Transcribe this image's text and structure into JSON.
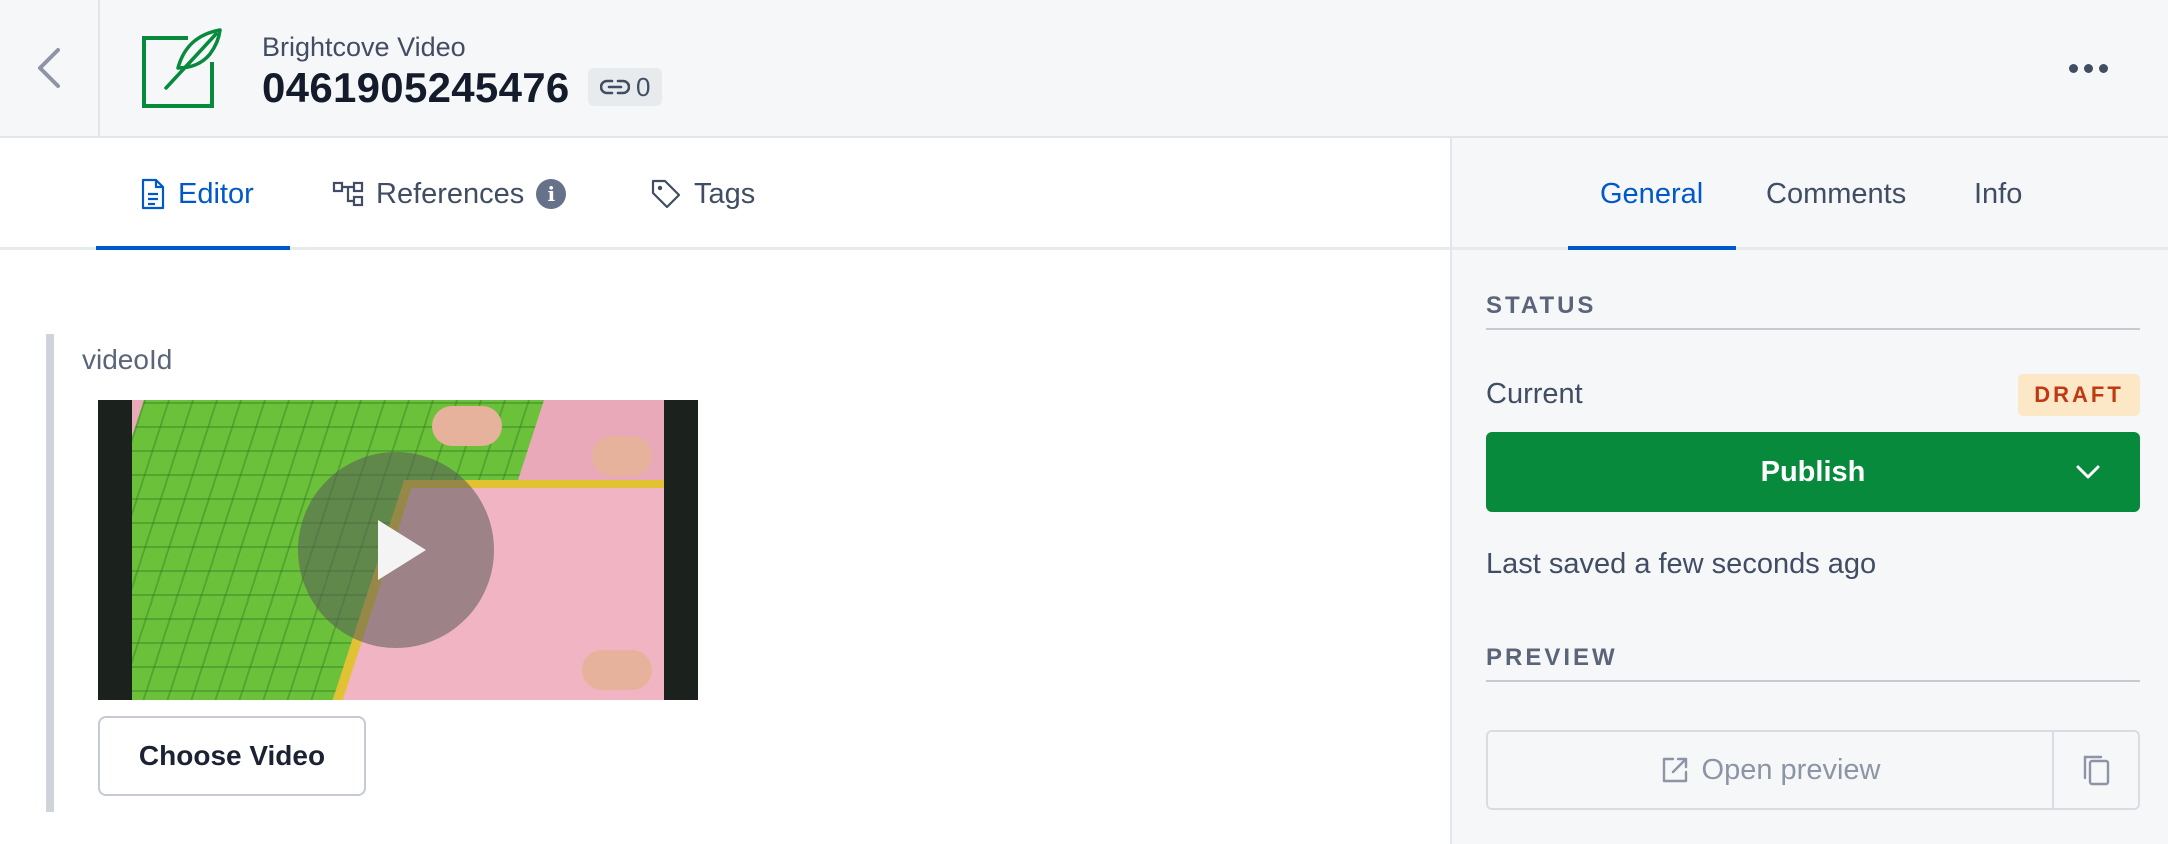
{
  "header": {
    "content_type": "Brightcove Video",
    "title": "0461905245476",
    "reference_count": "0",
    "icons": {
      "back": "chevron-left-icon",
      "entry": "feather-icon",
      "link": "link-icon",
      "more": "more-horizontal-icon"
    }
  },
  "editor_tabs": [
    {
      "label": "Editor",
      "icon": "document-icon",
      "active": true
    },
    {
      "label": "References",
      "icon": "hierarchy-icon",
      "info_icon": "info-icon",
      "active": false
    },
    {
      "label": "Tags",
      "icon": "tag-icon",
      "active": false
    }
  ],
  "field": {
    "label": "videoId",
    "choose_button": "Choose Video",
    "video_icon": "play-icon"
  },
  "sidebar": {
    "tabs": [
      {
        "label": "General",
        "active": true
      },
      {
        "label": "Comments",
        "active": false
      },
      {
        "label": "Info",
        "active": false
      }
    ],
    "status_title": "STATUS",
    "current_label": "Current",
    "status_badge": "DRAFT",
    "publish_label": "Publish",
    "last_saved": "Last saved a few seconds ago",
    "preview_title": "PREVIEW",
    "open_preview_label": "Open preview",
    "icons": {
      "caret": "chevron-down-icon",
      "external": "external-link-icon",
      "copy": "copy-icon"
    }
  },
  "colors": {
    "accent": "#0059c8",
    "publish": "#078a3c",
    "draft_bg": "#fce7c6",
    "draft_text": "#bf3a12",
    "entry_icon": "#078a3c"
  }
}
